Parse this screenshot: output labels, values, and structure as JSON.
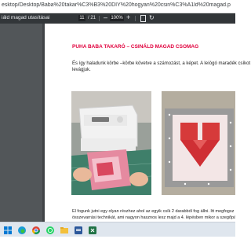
{
  "browser": {
    "url": "esktop/Desktop/Baba%20takar%C3%B3%20DIY%20hogyan%20csin%C3%A1ld%20magad.pdf"
  },
  "pdf_toolbar": {
    "tab_title": "iáld magad utasításai",
    "page_current": "11",
    "page_total": "/ 21",
    "zoom_value": "100%",
    "zoom_out_label": "–",
    "zoom_in_label": "+"
  },
  "document": {
    "title": "PUHA BABA TAKARÓ – CSINÁLD MAGAD CSOMAG",
    "intro_line1": "És így haladunk körbe –körbe követve a számozást, a képet. A leíógó maradék csíkot",
    "intro_line2": "levágjuk.",
    "body_line1": "El fogunk jutni egy olyan részhez ahol az egyik csík 2 darabból fog állni. Itt megfogsz tanulni egy",
    "body_line2": "összevarrási technikát, ami nagyon hasznos lesz majd a 4. lépésben mikor a szegőpántot fogjuk"
  },
  "colors": {
    "title_red": "#e0003c",
    "toolbar_bg": "#323639",
    "viewer_bg": "#525659"
  },
  "taskbar": {
    "icons": [
      "windows-icon",
      "edge-icon",
      "chrome-icon",
      "whatsapp-icon",
      "file-explorer-icon",
      "word-icon",
      "excel-icon"
    ]
  }
}
